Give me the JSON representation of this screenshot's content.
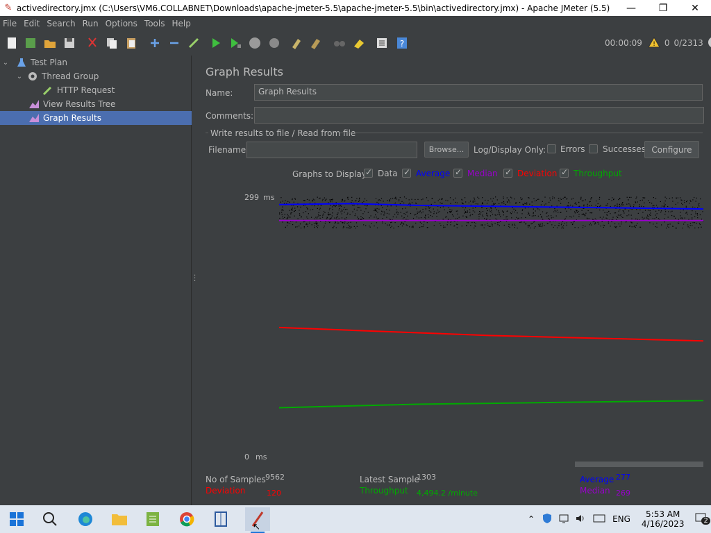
{
  "window": {
    "title": "activedirectory.jmx (C:\\Users\\VM6.COLLABNET\\Downloads\\apache-jmeter-5.5\\apache-jmeter-5.5\\bin\\activedirectory.jmx) - Apache JMeter (5.5)",
    "minimize": "—",
    "maximize": "❐",
    "close": "✕"
  },
  "menu": [
    "File",
    "Edit",
    "Search",
    "Run",
    "Options",
    "Tools",
    "Help"
  ],
  "toolbar": {
    "timer": "00:00:09",
    "warnings": "0",
    "threads": "0/2313"
  },
  "tree": {
    "items": [
      {
        "label": "Test Plan"
      },
      {
        "label": "Thread Group"
      },
      {
        "label": "HTTP Request"
      },
      {
        "label": "View Results Tree"
      },
      {
        "label": "Graph Results"
      }
    ]
  },
  "panel": {
    "title": "Graph Results",
    "name_label": "Name:",
    "name_value": "Graph Results",
    "comments_label": "Comments:",
    "comments_value": "",
    "file_group_label": "Write results to file / Read from file",
    "filename_label": "Filename",
    "filename_value": "",
    "browse_label": "Browse...",
    "log_display_label": "Log/Display Only:",
    "errors_label": "Errors",
    "successes_label": "Successes",
    "configure_label": "Configure",
    "graphs_to_display_label": "Graphs to Display",
    "graph_options": [
      {
        "label": "Data",
        "color": "#bbbbbb",
        "checked": true
      },
      {
        "label": "Average",
        "color": "#0000ff",
        "checked": true
      },
      {
        "label": "Median",
        "color": "#9900cc",
        "checked": true
      },
      {
        "label": "Deviation",
        "color": "#ff0000",
        "checked": true
      },
      {
        "label": "Throughput",
        "color": "#00aa00",
        "checked": true
      }
    ]
  },
  "chart_data": {
    "type": "line",
    "y_max_label": "299",
    "y_min_label": "0",
    "y_unit": "ms",
    "ylim": [
      0,
      299
    ],
    "series": [
      {
        "name": "Average",
        "color": "#0000ff",
        "values": [
          286,
          287,
          285,
          284,
          283,
          282,
          281
        ]
      },
      {
        "name": "Median",
        "color": "#9900cc",
        "values": [
          268,
          268,
          268,
          268,
          268,
          268,
          268
        ]
      },
      {
        "name": "Deviation",
        "color": "#ff0000",
        "values": [
          148,
          145,
          142,
          139,
          137,
          135,
          133
        ]
      },
      {
        "name": "Throughput",
        "color": "#00aa00",
        "values": [
          58,
          60,
          62,
          63,
          64,
          65,
          66
        ]
      }
    ]
  },
  "stats": {
    "samples_label": "No of Samples",
    "samples_value": "9562",
    "latest_label": "Latest Sample",
    "latest_value": "1303",
    "average_label": "Average",
    "average_value": "277",
    "deviation_label": "Deviation",
    "deviation_value": "120",
    "throughput_label": "Throughput",
    "throughput_value": "4,494.2 /minute",
    "median_label": "Median",
    "median_value": "269"
  },
  "taskbar": {
    "lang": "ENG",
    "time": "5:53 AM",
    "date": "4/16/2023",
    "notif_count": "2"
  }
}
